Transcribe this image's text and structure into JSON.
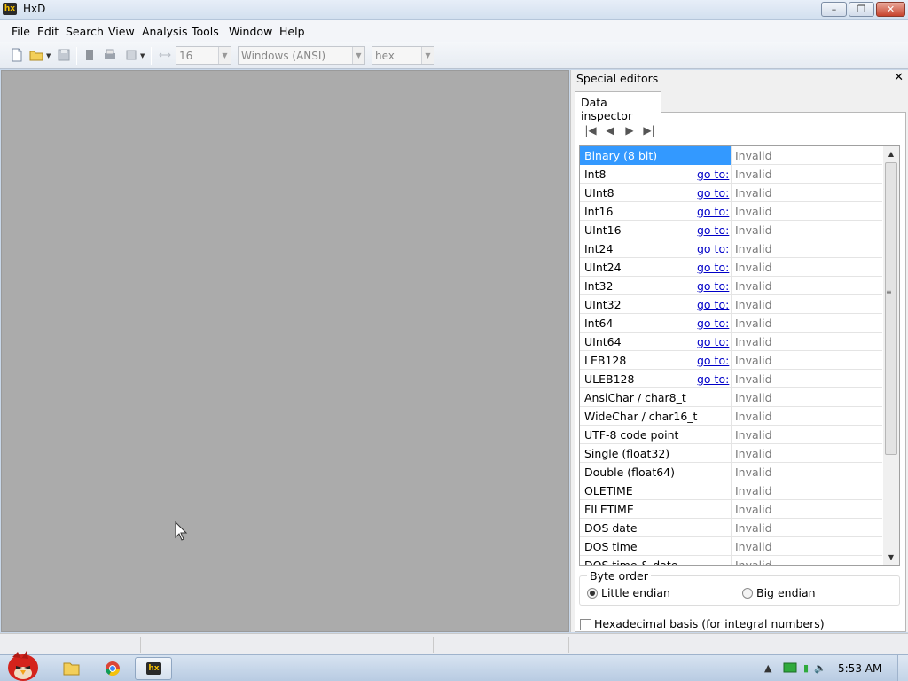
{
  "window": {
    "title": "HxD",
    "app_icon": "hxd-logo-icon"
  },
  "menu": [
    "File",
    "Edit",
    "Search",
    "View",
    "Analysis",
    "Tools",
    "Window",
    "Help"
  ],
  "toolbar": {
    "bytes_per_row": "16",
    "charset": "Windows (ANSI)",
    "offset_base": "hex"
  },
  "panel": {
    "title": "Special editors",
    "tab_label": "Data inspector",
    "rows": [
      {
        "name": "Binary (8 bit)",
        "goto": "",
        "value": "Invalid",
        "selected": true
      },
      {
        "name": "Int8",
        "goto": "go to:",
        "value": "Invalid"
      },
      {
        "name": "UInt8",
        "goto": "go to:",
        "value": "Invalid"
      },
      {
        "name": "Int16",
        "goto": "go to:",
        "value": "Invalid"
      },
      {
        "name": "UInt16",
        "goto": "go to:",
        "value": "Invalid"
      },
      {
        "name": "Int24",
        "goto": "go to:",
        "value": "Invalid"
      },
      {
        "name": "UInt24",
        "goto": "go to:",
        "value": "Invalid"
      },
      {
        "name": "Int32",
        "goto": "go to:",
        "value": "Invalid"
      },
      {
        "name": "UInt32",
        "goto": "go to:",
        "value": "Invalid"
      },
      {
        "name": "Int64",
        "goto": "go to:",
        "value": "Invalid"
      },
      {
        "name": "UInt64",
        "goto": "go to:",
        "value": "Invalid"
      },
      {
        "name": "LEB128",
        "goto": "go to:",
        "value": "Invalid"
      },
      {
        "name": "ULEB128",
        "goto": "go to:",
        "value": "Invalid"
      },
      {
        "name": "AnsiChar / char8_t",
        "goto": "",
        "value": "Invalid"
      },
      {
        "name": "WideChar / char16_t",
        "goto": "",
        "value": "Invalid"
      },
      {
        "name": "UTF-8 code point",
        "goto": "",
        "value": "Invalid"
      },
      {
        "name": "Single (float32)",
        "goto": "",
        "value": "Invalid"
      },
      {
        "name": "Double (float64)",
        "goto": "",
        "value": "Invalid"
      },
      {
        "name": "OLETIME",
        "goto": "",
        "value": "Invalid"
      },
      {
        "name": "FILETIME",
        "goto": "",
        "value": "Invalid"
      },
      {
        "name": "DOS date",
        "goto": "",
        "value": "Invalid"
      },
      {
        "name": "DOS time",
        "goto": "",
        "value": "Invalid"
      },
      {
        "name": "DOS time & date",
        "goto": "",
        "value": "Invalid"
      }
    ],
    "byte_order_label": "Byte order",
    "little_endian": "Little endian",
    "big_endian": "Big endian",
    "hex_basis_label": "Hexadecimal basis (for integral numbers)"
  },
  "taskbar": {
    "clock": "5:53 AM"
  },
  "colors": {
    "selection": "#3399ff",
    "link": "#0000c8",
    "workspace": "#ababab"
  }
}
